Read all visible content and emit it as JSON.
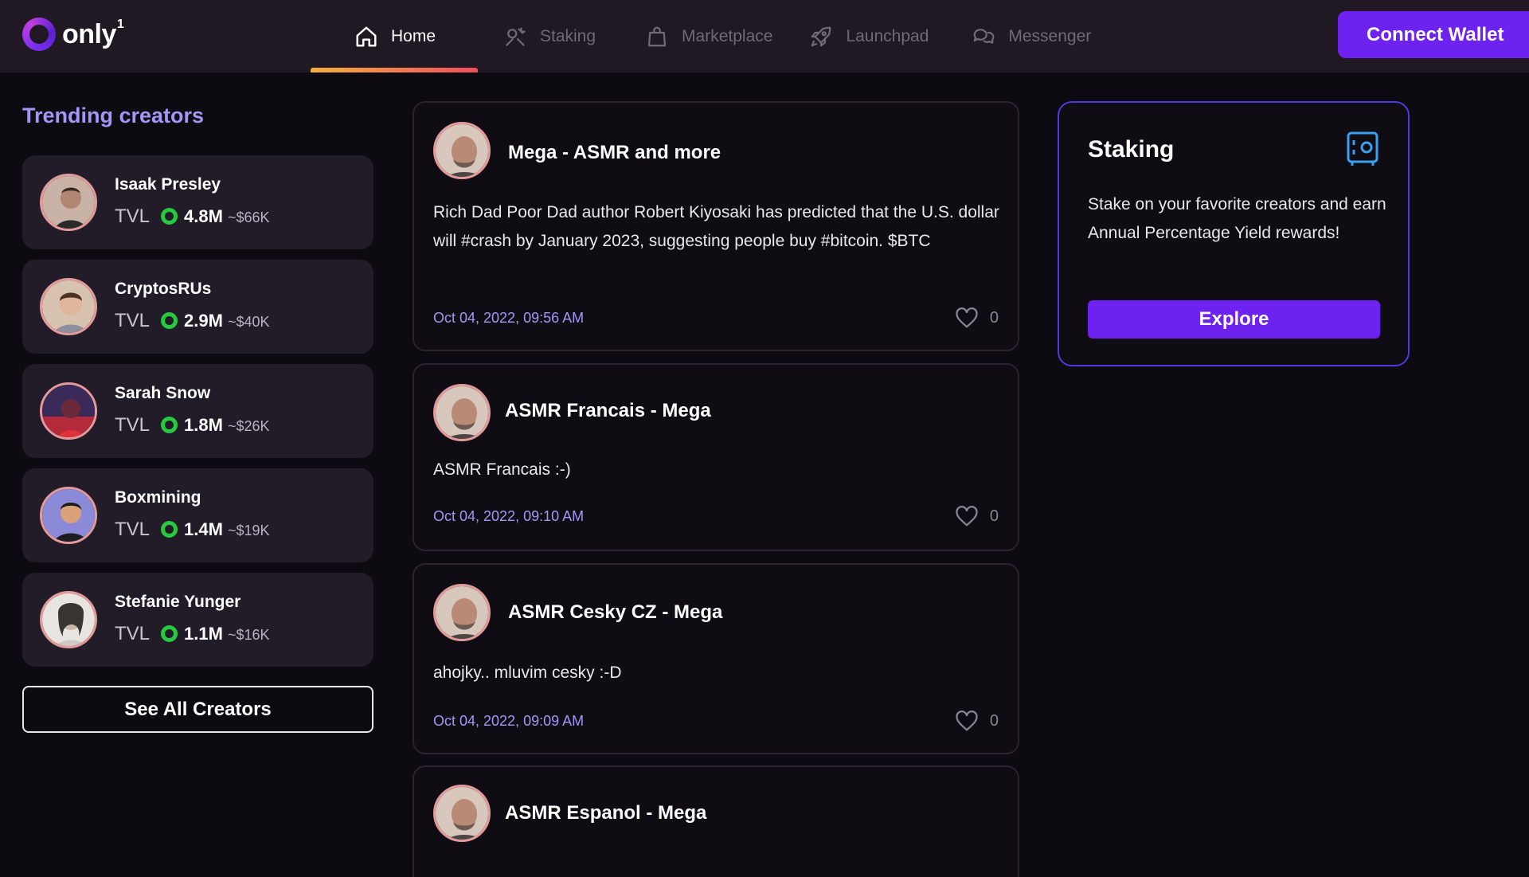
{
  "app": {
    "logo_text": "only",
    "logo_sup": "1"
  },
  "nav": {
    "items": [
      {
        "label": "Home",
        "icon": "home-icon",
        "active": true
      },
      {
        "label": "Staking",
        "icon": "staking-icon",
        "active": false
      },
      {
        "label": "Marketplace",
        "icon": "shopping-bag-icon",
        "active": false
      },
      {
        "label": "Launchpad",
        "icon": "rocket-icon",
        "active": false
      },
      {
        "label": "Messenger",
        "icon": "chat-bubbles-icon",
        "active": false
      }
    ],
    "connect_label": "Connect Wallet"
  },
  "trending": {
    "title": "Trending creators",
    "tvl_label": "TVL",
    "creators": [
      {
        "name": "Isaak Presley",
        "tvl": "4.8M",
        "usd": "~$66K"
      },
      {
        "name": "CryptosRUs",
        "tvl": "2.9M",
        "usd": "~$40K"
      },
      {
        "name": "Sarah Snow",
        "tvl": "1.8M",
        "usd": "~$26K"
      },
      {
        "name": "Boxmining",
        "tvl": "1.4M",
        "usd": "~$19K"
      },
      {
        "name": "Stefanie Yunger",
        "tvl": "1.1M",
        "usd": "~$16K"
      }
    ],
    "see_all_label": "See All Creators"
  },
  "posts": [
    {
      "title": "Mega - ASMR and more",
      "body": "Rich Dad Poor Dad author Robert Kiyosaki has predicted that the U.S. dollar will #crash by January 2023, suggesting people buy #bitcoin. $BTC",
      "date": "Oct 04, 2022, 09:56 AM",
      "likes": "0"
    },
    {
      "title": "ASMR Francais - Mega",
      "body": "ASMR Francais :-)",
      "date": "Oct 04, 2022, 09:10 AM",
      "likes": "0"
    },
    {
      "title": "ASMR Cesky CZ - Mega",
      "body": "ahojky.. mluvim cesky :-D",
      "date": "Oct 04, 2022, 09:09 AM",
      "likes": "0"
    },
    {
      "title": "ASMR Espanol - Mega"
    }
  ],
  "staking_card": {
    "title": "Staking",
    "description": "Stake on your favorite creators and earn Annual Percentage Yield rewards!",
    "button_label": "Explore",
    "icon": "safe-icon"
  },
  "colors": {
    "accent_purple": "#6d22f0",
    "lavender": "#a695f6",
    "tvl_green": "#27c93f",
    "nav_bg": "#201823"
  }
}
